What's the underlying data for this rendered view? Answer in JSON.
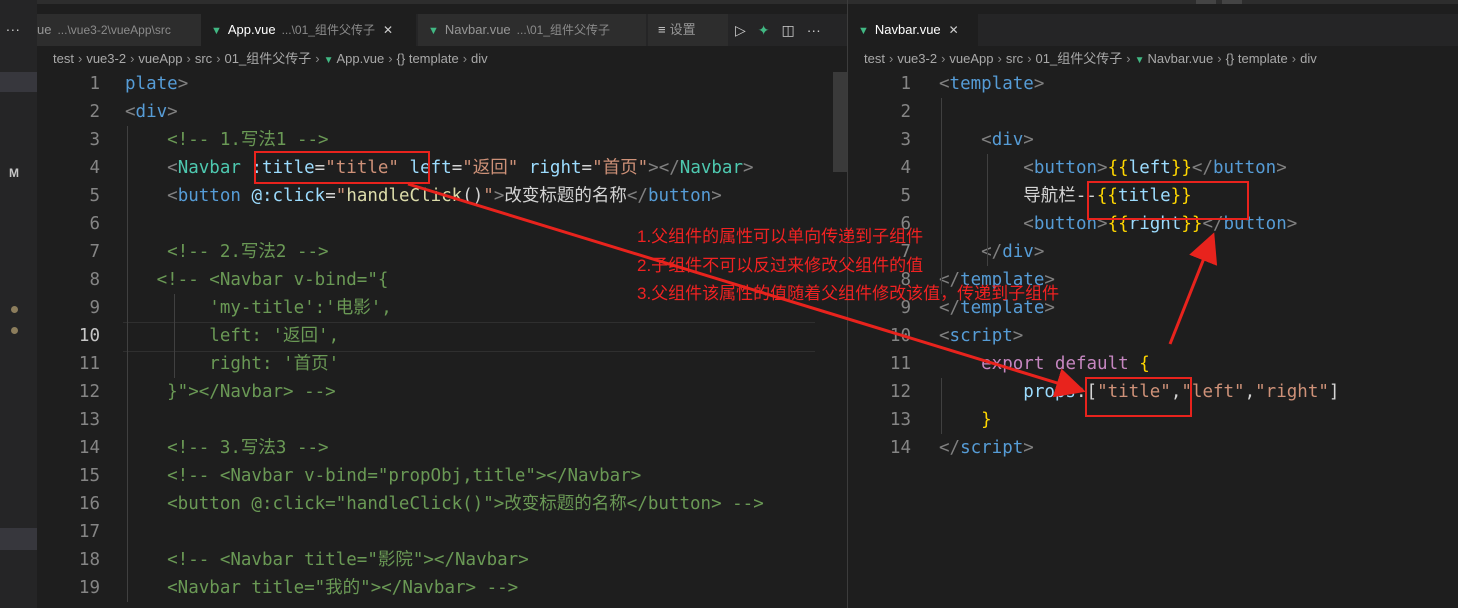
{
  "left_editor": {
    "tabs": [
      {
        "label": "ue",
        "desc": "...\\vue3-2\\vueApp\\src"
      },
      {
        "label": "App.vue",
        "desc": "...\\01_组件父传子",
        "active": true
      },
      {
        "label": "Navbar.vue",
        "desc": "...\\01_组件父传子"
      },
      {
        "label": "设置"
      }
    ],
    "more_icon": "...",
    "breadcrumb": [
      "test",
      "vue3-2",
      "vueApp",
      "src",
      "01_组件父传子",
      "App.vue",
      "{} template",
      "div"
    ],
    "lines": [
      {
        "n": "1",
        "tokens": [
          [
            "tag",
            "plate"
          ],
          [
            "pun",
            ">"
          ]
        ]
      },
      {
        "n": "2",
        "tokens": [
          [
            "pun",
            "<"
          ],
          [
            "tag",
            "div"
          ],
          [
            "pun",
            ">"
          ]
        ]
      },
      {
        "n": "3",
        "tokens": [
          [
            "cmt",
            "    <!-- 1.写法1 -->"
          ]
        ]
      },
      {
        "n": "4",
        "tokens": [
          [
            "pun",
            "    <"
          ],
          [
            "comp",
            "Navbar"
          ],
          [
            "plain",
            " "
          ],
          [
            "attr",
            ":title"
          ],
          [
            "plain",
            "="
          ],
          [
            "str",
            "\"title\""
          ],
          [
            "plain",
            " "
          ],
          [
            "attr",
            "left"
          ],
          [
            "plain",
            "="
          ],
          [
            "str",
            "\"返回\""
          ],
          [
            "plain",
            " "
          ],
          [
            "attr",
            "right"
          ],
          [
            "plain",
            "="
          ],
          [
            "str",
            "\"首页\""
          ],
          [
            "pun",
            "></"
          ],
          [
            "comp",
            "Navbar"
          ],
          [
            "pun",
            ">"
          ]
        ]
      },
      {
        "n": "5",
        "tokens": [
          [
            "pun",
            "    <"
          ],
          [
            "tag",
            "button"
          ],
          [
            "plain",
            " "
          ],
          [
            "attr",
            "@:click"
          ],
          [
            "plain",
            "="
          ],
          [
            "str",
            "\""
          ],
          [
            "fn",
            "handleClick"
          ],
          [
            "plain",
            "()"
          ],
          [
            "str",
            "\""
          ],
          [
            "pun",
            ">"
          ],
          [
            "plain",
            "改变标题的名称"
          ],
          [
            "pun",
            "</"
          ],
          [
            "tag",
            "button"
          ],
          [
            "pun",
            ">"
          ]
        ]
      },
      {
        "n": "6",
        "tokens": []
      },
      {
        "n": "7",
        "tokens": [
          [
            "cmt",
            "    <!-- 2.写法2 -->"
          ]
        ]
      },
      {
        "n": "8",
        "tokens": [
          [
            "cmt",
            "   <!-- <Navbar v-bind=\"{"
          ]
        ]
      },
      {
        "n": "9",
        "tokens": [
          [
            "cmt",
            "        'my-title':'电影',"
          ]
        ]
      },
      {
        "n": "10",
        "tokens": [
          [
            "cmt",
            "        left: '返回',"
          ]
        ],
        "current": true
      },
      {
        "n": "11",
        "tokens": [
          [
            "cmt",
            "        right: '首页'"
          ]
        ]
      },
      {
        "n": "12",
        "tokens": [
          [
            "cmt",
            "    }\"></Navbar> -->"
          ]
        ]
      },
      {
        "n": "13",
        "tokens": []
      },
      {
        "n": "14",
        "tokens": [
          [
            "cmt",
            "    <!-- 3.写法3 -->"
          ]
        ]
      },
      {
        "n": "15",
        "tokens": [
          [
            "cmt",
            "    <!-- <Navbar v-bind=\"propObj,title\"></Navbar>"
          ]
        ]
      },
      {
        "n": "16",
        "tokens": [
          [
            "cmt",
            "    <button @:click=\"handleClick()\">改变标题的名称</button> -->"
          ]
        ]
      },
      {
        "n": "17",
        "tokens": []
      },
      {
        "n": "18",
        "tokens": [
          [
            "cmt",
            "    <!-- <Navbar title=\"影院\"></Navbar>"
          ]
        ]
      },
      {
        "n": "19",
        "tokens": [
          [
            "cmt",
            "    <Navbar title=\"我的\"></Navbar> -->"
          ]
        ]
      }
    ]
  },
  "right_editor": {
    "tab": {
      "label": "Navbar.vue"
    },
    "breadcrumb": [
      "test",
      "vue3-2",
      "vueApp",
      "src",
      "01_组件父传子",
      "Navbar.vue",
      "{} template",
      "div"
    ],
    "lines": [
      {
        "n": "1",
        "tokens": [
          [
            "pun",
            "<"
          ],
          [
            "tag",
            "template"
          ],
          [
            "pun",
            ">"
          ]
        ]
      },
      {
        "n": "2",
        "tokens": []
      },
      {
        "n": "3",
        "tokens": [
          [
            "pun",
            "    <"
          ],
          [
            "tag",
            "div"
          ],
          [
            "pun",
            ">"
          ]
        ]
      },
      {
        "n": "4",
        "tokens": [
          [
            "pun",
            "        <"
          ],
          [
            "tag",
            "button"
          ],
          [
            "pun",
            ">"
          ],
          [
            "br",
            "{{"
          ],
          [
            "attr",
            "left"
          ],
          [
            "br",
            "}}"
          ],
          [
            "pun",
            "</"
          ],
          [
            "tag",
            "button"
          ],
          [
            "pun",
            ">"
          ]
        ]
      },
      {
        "n": "5",
        "tokens": [
          [
            "plain",
            "        导航栏--"
          ],
          [
            "br",
            "{{"
          ],
          [
            "attr",
            "title"
          ],
          [
            "br",
            "}}"
          ]
        ]
      },
      {
        "n": "6",
        "tokens": [
          [
            "pun",
            "        <"
          ],
          [
            "tag",
            "button"
          ],
          [
            "pun",
            ">"
          ],
          [
            "br",
            "{{"
          ],
          [
            "attr",
            "right"
          ],
          [
            "br",
            "}}"
          ],
          [
            "pun",
            "</"
          ],
          [
            "tag",
            "button"
          ],
          [
            "pun",
            ">"
          ]
        ]
      },
      {
        "n": "7",
        "tokens": [
          [
            "pun",
            "    </"
          ],
          [
            "tag",
            "div"
          ],
          [
            "pun",
            ">"
          ]
        ]
      },
      {
        "n": "8",
        "tokens": [
          [
            "pun",
            "</"
          ],
          [
            "tag",
            "template"
          ],
          [
            "pun",
            ">"
          ]
        ]
      },
      {
        "n": "9",
        "tokens": [
          [
            "pun",
            "</"
          ],
          [
            "tag",
            "template"
          ],
          [
            "pun",
            ">"
          ]
        ]
      },
      {
        "n": "10",
        "tokens": [
          [
            "pun",
            "<"
          ],
          [
            "tag",
            "script"
          ],
          [
            "pun",
            ">"
          ]
        ]
      },
      {
        "n": "11",
        "tokens": [
          [
            "kw",
            "    export"
          ],
          [
            "plain",
            " "
          ],
          [
            "kw",
            "default"
          ],
          [
            "plain",
            " "
          ],
          [
            "br",
            "{"
          ]
        ]
      },
      {
        "n": "12",
        "tokens": [
          [
            "attr",
            "        props"
          ],
          [
            "plain",
            ":"
          ],
          [
            "plain",
            "["
          ],
          [
            "str",
            "\"title\""
          ],
          [
            "plain",
            ","
          ],
          [
            "str",
            "\"left\""
          ],
          [
            "plain",
            ","
          ],
          [
            "str",
            "\"right\""
          ],
          [
            "plain",
            "]"
          ]
        ]
      },
      {
        "n": "13",
        "tokens": [
          [
            "br",
            "    }"
          ]
        ]
      },
      {
        "n": "14",
        "tokens": [
          [
            "pun",
            "</"
          ],
          [
            "tag",
            "script"
          ],
          [
            "pun",
            ">"
          ]
        ]
      }
    ]
  },
  "annotations": [
    "1.父组件的属性可以单向传递到子组件",
    "2.子组件不可以反过来修改父组件的值",
    "3.父组件该属性的值随着父组件修改该值，传递到子组件"
  ],
  "colors": {
    "annotation": "#e8231d",
    "vue_icon": "#41b883"
  }
}
